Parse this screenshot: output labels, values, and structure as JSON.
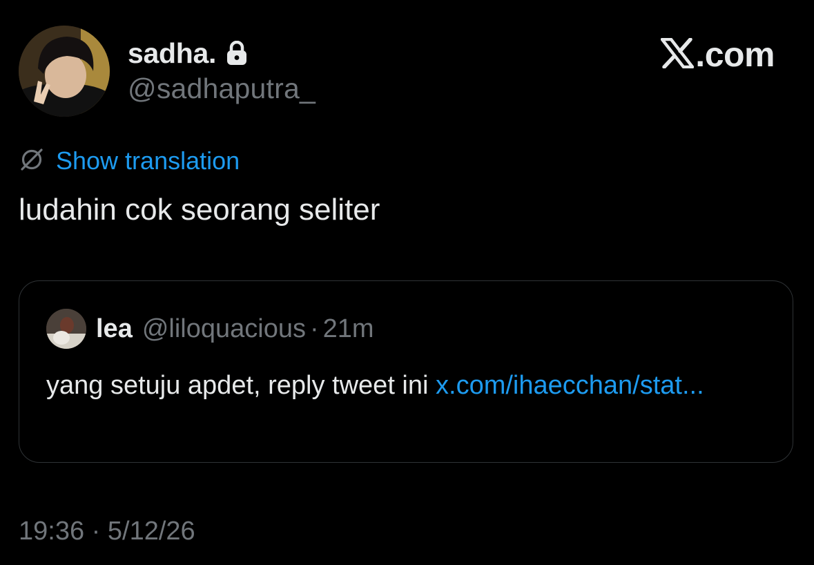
{
  "author": {
    "display_name": "sadha.",
    "handle": "@sadhaputra_",
    "protected_icon": "lock-icon"
  },
  "brand": {
    "logo_icon": "x-logo-icon",
    "logo_text": ".com"
  },
  "translation": {
    "icon": "globe-slash-icon",
    "label": "Show translation"
  },
  "tweet": {
    "text": "ludahin cok seorang seliter"
  },
  "quote": {
    "name": "lea",
    "handle": "@liloquacious",
    "separator": "·",
    "time": "21m",
    "text": "yang setuju apdet, reply tweet ini ",
    "link": "x.com/ihaecchan/stat..."
  },
  "footer": {
    "time": "19:36",
    "separator": "·",
    "date": "5/12/26"
  },
  "colors": {
    "background": "#000000",
    "primary_text": "#e7e9ea",
    "secondary_text": "#71767b",
    "link": "#1d9bf0",
    "border": "#2f3336"
  }
}
